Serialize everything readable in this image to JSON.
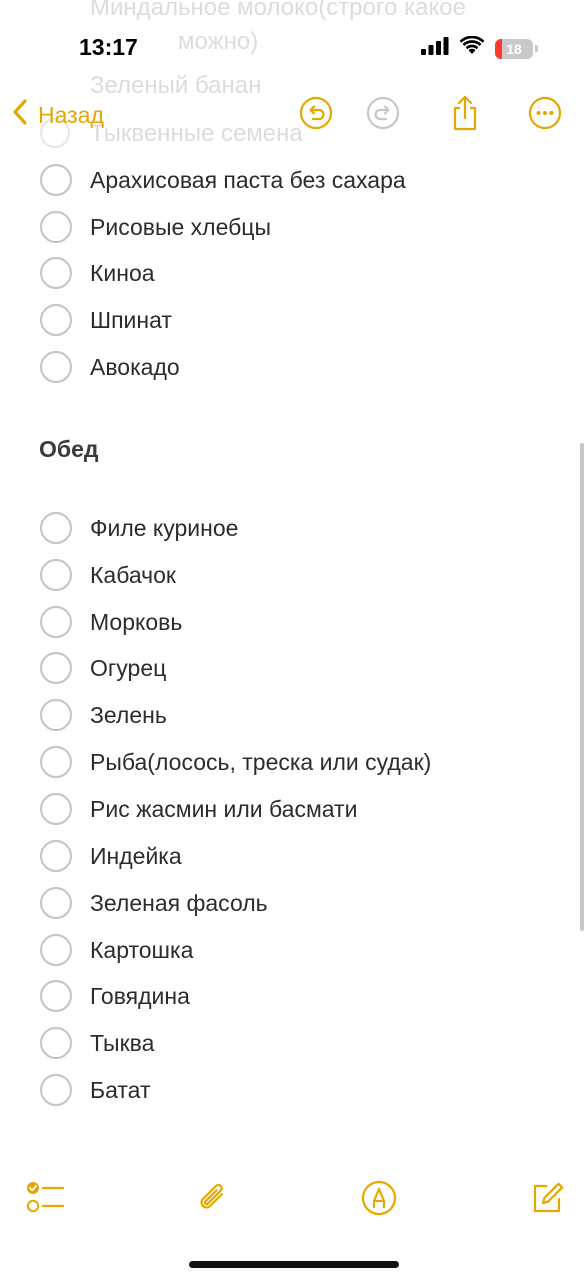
{
  "status_bar": {
    "time": "13:17",
    "battery_level": "18",
    "battery_fraction": 0.18
  },
  "ghost_lines": [
    "Миндальное молоко(строго какое",
    "можно)",
    "Зеленый банан",
    "Тыквенные семена"
  ],
  "nav": {
    "back_label": "Назад",
    "accent_color": "#e5a800"
  },
  "checklist_top": [
    "Арахисовая паста без сахара",
    "Рисовые хлебцы",
    "Киноа",
    "Шпинат",
    "Авокадо"
  ],
  "section": {
    "heading": "Обед"
  },
  "checklist_lunch": [
    "Филе куриное",
    "Кабачок",
    "Морковь",
    "Огурец",
    "Зелень",
    "Рыба(лосось, треска или судак)",
    "Рис жасмин или басмати",
    "Индейка",
    "Зеленая фасоль",
    "Картошка",
    "Говядина",
    "Тыква",
    "Батат"
  ],
  "toolbar": {
    "icons": [
      "checklist-icon",
      "paperclip-icon",
      "markup-pen-icon",
      "compose-icon"
    ]
  }
}
